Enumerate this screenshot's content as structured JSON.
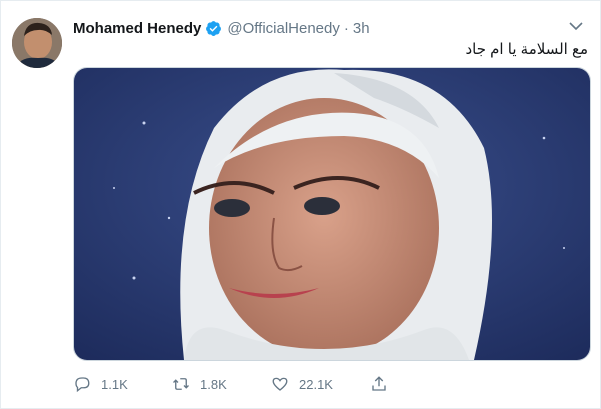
{
  "tweet": {
    "author_name": "Mohamed Henedy",
    "handle": "@OfficialHenedy",
    "separator": "·",
    "time": "3h",
    "text": "مع السلامة يا ام جاد",
    "verified": true
  },
  "actions": {
    "reply_count": "1.1K",
    "retweet_count": "1.8K",
    "like_count": "22.1K"
  },
  "colors": {
    "verified_badge": "#1da1f2",
    "secondary_text": "#657786",
    "primary_text": "#14171a"
  },
  "icons": [
    "caret-down-icon",
    "verified-badge-icon",
    "reply-icon",
    "retweet-icon",
    "like-icon",
    "share-icon"
  ]
}
